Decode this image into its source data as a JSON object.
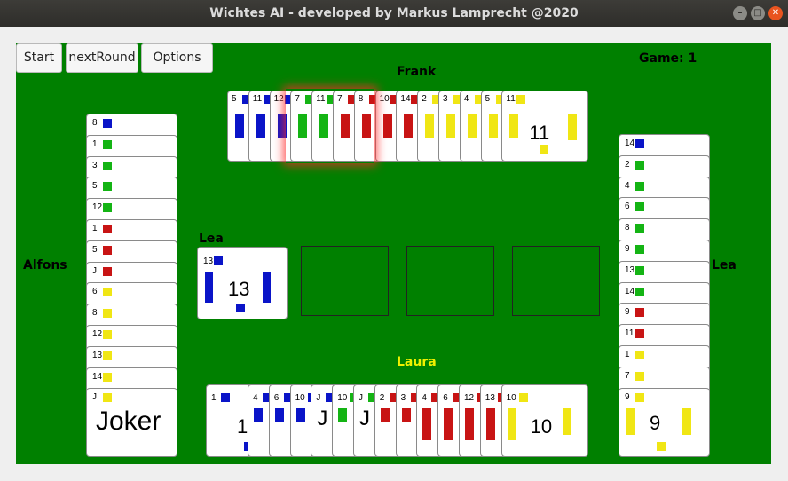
{
  "window": {
    "title": "Wichtes AI - developed by Markus Lamprecht @2020"
  },
  "controls": {
    "start": "Start",
    "next_round": "nextRound",
    "options": "Options"
  },
  "status": {
    "game": "Game: 1"
  },
  "colors": {
    "blue": "#0a14c8",
    "green": "#14b414",
    "red": "#c81414",
    "yellow": "#f0e614",
    "table": "#008000",
    "active_player": "#f0f000"
  },
  "players": {
    "top": {
      "name": "Frank",
      "cards": [
        {
          "rank": "5",
          "suit": "blue"
        },
        {
          "rank": "11",
          "suit": "blue"
        },
        {
          "rank": "12",
          "suit": "blue"
        },
        {
          "rank": "7",
          "suit": "green"
        },
        {
          "rank": "11",
          "suit": "green"
        },
        {
          "rank": "7",
          "suit": "red"
        },
        {
          "rank": "8",
          "suit": "red"
        },
        {
          "rank": "10",
          "suit": "red"
        },
        {
          "rank": "14",
          "suit": "red"
        },
        {
          "rank": "2",
          "suit": "yellow"
        },
        {
          "rank": "3",
          "suit": "yellow"
        },
        {
          "rank": "4",
          "suit": "yellow"
        },
        {
          "rank": "5",
          "suit": "yellow"
        },
        {
          "rank": "11",
          "suit": "yellow"
        }
      ]
    },
    "left": {
      "name": "Alfons",
      "cards": [
        {
          "rank": "8",
          "suit": "blue"
        },
        {
          "rank": "1",
          "suit": "green"
        },
        {
          "rank": "3",
          "suit": "green"
        },
        {
          "rank": "5",
          "suit": "green"
        },
        {
          "rank": "12",
          "suit": "green"
        },
        {
          "rank": "1",
          "suit": "red"
        },
        {
          "rank": "5",
          "suit": "red"
        },
        {
          "rank": "J",
          "suit": "red"
        },
        {
          "rank": "6",
          "suit": "yellow"
        },
        {
          "rank": "8",
          "suit": "yellow"
        },
        {
          "rank": "12",
          "suit": "yellow"
        },
        {
          "rank": "13",
          "suit": "yellow"
        },
        {
          "rank": "14",
          "suit": "yellow"
        },
        {
          "rank": "J",
          "suit": "yellow",
          "face": "Joker"
        }
      ]
    },
    "right": {
      "name": "Lea",
      "cards": [
        {
          "rank": "14",
          "suit": "blue"
        },
        {
          "rank": "2",
          "suit": "green"
        },
        {
          "rank": "4",
          "suit": "green"
        },
        {
          "rank": "6",
          "suit": "green"
        },
        {
          "rank": "8",
          "suit": "green"
        },
        {
          "rank": "9",
          "suit": "green"
        },
        {
          "rank": "13",
          "suit": "green"
        },
        {
          "rank": "14",
          "suit": "green"
        },
        {
          "rank": "9",
          "suit": "red"
        },
        {
          "rank": "11",
          "suit": "red"
        },
        {
          "rank": "1",
          "suit": "yellow"
        },
        {
          "rank": "7",
          "suit": "yellow"
        },
        {
          "rank": "9",
          "suit": "yellow"
        }
      ]
    },
    "bottom": {
      "name": "Laura",
      "cards": [
        {
          "rank": "1",
          "suit": "blue"
        },
        {
          "rank": "4",
          "suit": "blue"
        },
        {
          "rank": "6",
          "suit": "blue"
        },
        {
          "rank": "10",
          "suit": "blue"
        },
        {
          "rank": "J",
          "suit": "blue"
        },
        {
          "rank": "10",
          "suit": "green"
        },
        {
          "rank": "J",
          "suit": "green"
        },
        {
          "rank": "2",
          "suit": "red"
        },
        {
          "rank": "3",
          "suit": "red"
        },
        {
          "rank": "4",
          "suit": "red"
        },
        {
          "rank": "6",
          "suit": "red"
        },
        {
          "rank": "12",
          "suit": "red"
        },
        {
          "rank": "13",
          "suit": "red"
        },
        {
          "rank": "10",
          "suit": "yellow"
        }
      ]
    }
  },
  "trick": {
    "played_by": "Lea",
    "card": {
      "rank": "13",
      "suit": "blue"
    }
  }
}
